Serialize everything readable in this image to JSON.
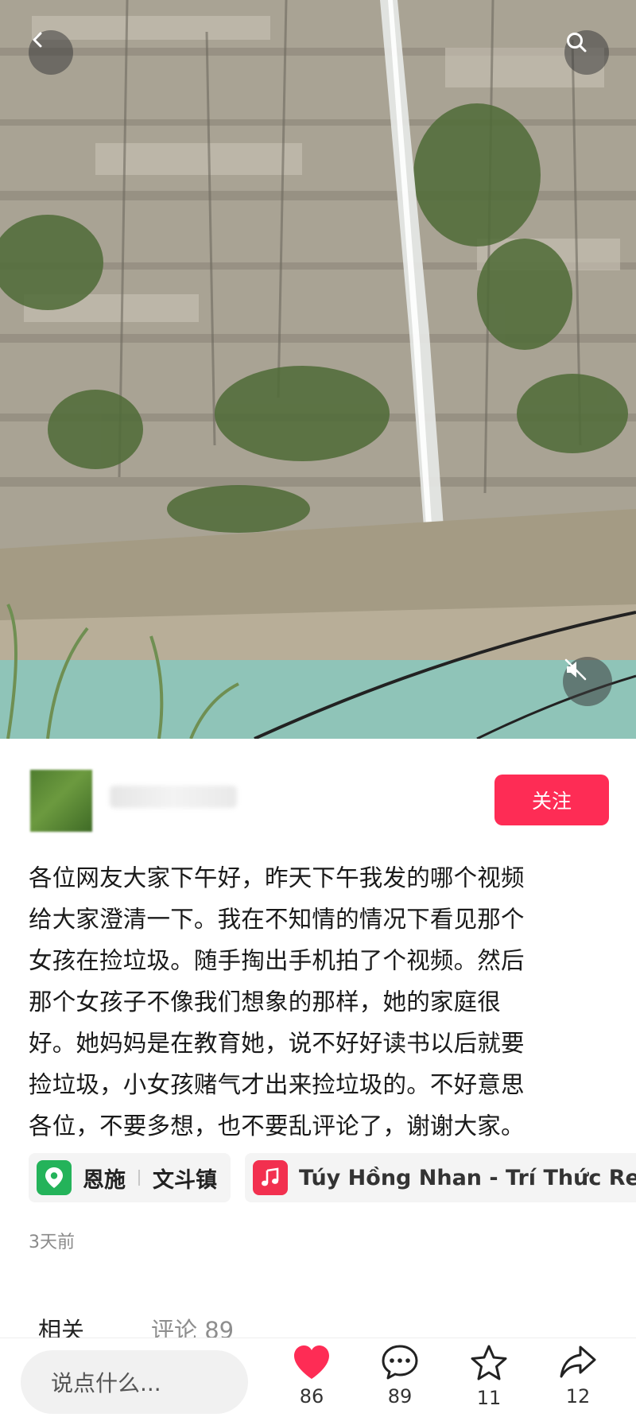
{
  "author": {
    "follow_label": "关注"
  },
  "post": {
    "lines": [
      "各位网友大家下午好，昨天下午我发的哪个视频",
      "给大家澄清一下。我在不知情的情况下看见那个",
      "女孩在捡垃圾。随手掏出手机拍了个视频。然后",
      "那个女孩子不像我们想象的那样，她的家庭很",
      "好。她妈妈是在教育她，说不好好读书以后就要",
      "捡垃圾，小女孩赌气才出来捡垃圾的。不好意思",
      "各位，不要多想，也不要乱评论了，谢谢大家。"
    ],
    "location_city": "恩施",
    "location_town": "文斗镇",
    "music": "Túy Hồng Nhan - Trí Thức Remi",
    "time": "3天前"
  },
  "tabs": {
    "related": "相关",
    "comments": "评论 89"
  },
  "bottom": {
    "input_placeholder": "说点什么...",
    "likes": "86",
    "comments": "89",
    "favorites": "11",
    "shares": "12"
  },
  "colors": {
    "accent": "#fe2c55",
    "location_green": "#24b35a",
    "music_red": "#f2304f"
  },
  "icons": [
    "back-icon",
    "search-icon",
    "mute-icon",
    "location-pin-icon",
    "music-note-icon",
    "heart-icon",
    "comment-icon",
    "star-icon",
    "share-icon"
  ]
}
